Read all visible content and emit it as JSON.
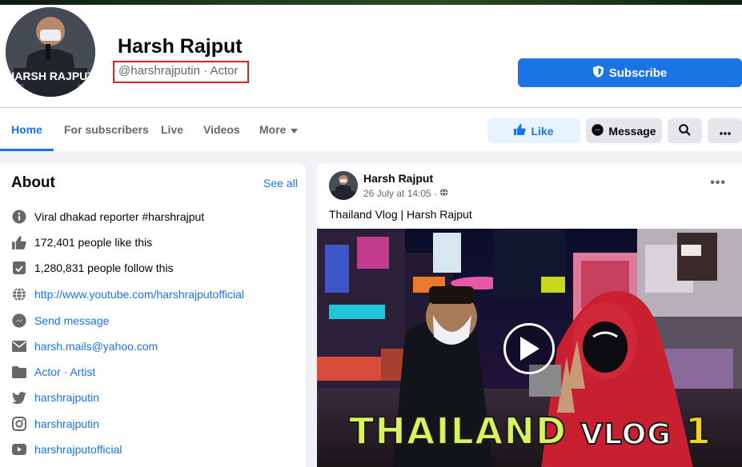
{
  "profile": {
    "name": "Harsh Rajput",
    "handle": "@harshrajputin · Actor",
    "avatar_text": "HARSH RAJPUT",
    "subscribe_label": "Subscribe"
  },
  "nav": {
    "tabs": [
      {
        "label": "Home",
        "active": true
      },
      {
        "label": "For subscribers",
        "active": false
      },
      {
        "label": "Live",
        "active": false
      },
      {
        "label": "Videos",
        "active": false
      },
      {
        "label": "More",
        "active": false
      }
    ],
    "like_label": "Like",
    "message_label": "Message"
  },
  "about": {
    "title": "About",
    "see_all": "See all",
    "items": [
      {
        "icon": "info-icon",
        "text": "Viral dhakad reporter #harshrajput",
        "link": false
      },
      {
        "icon": "thumbs-up-icon",
        "text": "172,401 people like this",
        "link": false
      },
      {
        "icon": "follow-icon",
        "text": "1,280,831 people follow this",
        "link": false
      },
      {
        "icon": "globe-icon",
        "text": "http://www.youtube.com/harshrajputofficial",
        "link": true
      },
      {
        "icon": "messenger-icon",
        "text": "Send message",
        "link": true
      },
      {
        "icon": "email-icon",
        "text": "harsh.mails@yahoo.com",
        "link": true
      },
      {
        "icon": "folder-icon",
        "text": "Actor · Artist",
        "link": true
      },
      {
        "icon": "twitter-icon",
        "text": "harshrajputin",
        "link": true
      },
      {
        "icon": "instagram-icon",
        "text": "harshrajputin",
        "link": true
      },
      {
        "icon": "youtube-icon",
        "text": "harshrajputofficial",
        "link": true
      }
    ]
  },
  "post": {
    "author": "Harsh Rajput",
    "time": "26 July at 14:05 ·",
    "text": "Thailand Vlog | Harsh Rajput",
    "video_title_main": "THAILAND",
    "video_title_vlog": "VLOG",
    "video_title_num": "1"
  },
  "colors": {
    "brand": "#1b74e4",
    "highlight_box": "#e02020"
  }
}
